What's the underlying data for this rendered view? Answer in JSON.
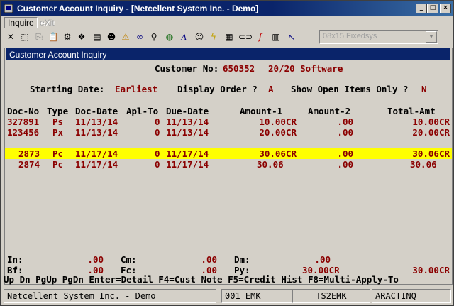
{
  "window": {
    "title": "Customer Account Inquiry - [Netcellent System Inc. - Demo]",
    "buttons": [
      "minimize",
      "maximize",
      "close"
    ]
  },
  "menu": {
    "items": [
      {
        "label": "Inquire",
        "enabled": true
      },
      {
        "label": "eXit",
        "enabled": false
      }
    ]
  },
  "toolbar": {
    "icons": [
      "close-x-icon",
      "select-icon",
      "copy-icon",
      "paste-icon",
      "settings-icon",
      "options-icon",
      "document-icon",
      "user-icon",
      "warning-icon",
      "binoculars-icon",
      "magnifier-icon",
      "globe-icon",
      "font-icon",
      "person-icon",
      "lightning-icon",
      "calculator-icon",
      "link-icon",
      "function-icon",
      "notepad-icon",
      "help-pointer-icon"
    ],
    "font_select": "08x15 Fixedsys"
  },
  "panel": {
    "title": "Customer Account Inquiry"
  },
  "header": {
    "customer_label": "Customer No:",
    "customer_no": "650352",
    "customer_name": "20/20 Software",
    "start_label": "Starting Date:",
    "start_value": "Earliest",
    "order_label": "Display Order ?",
    "order_value": "A",
    "open_label": "Show Open Items Only ?",
    "open_value": "N"
  },
  "columns": [
    "Doc-No",
    "Type",
    "Doc-Date",
    "Apl-To",
    "Due-Date",
    "Amount-1",
    "Amount-2",
    "Total-Amt"
  ],
  "rows": [
    {
      "doc_no": "327891",
      "type": "Ps",
      "doc_date": "11/13/14",
      "apl_to": "0",
      "due_date": "11/13/14",
      "amount1": "10.00CR",
      "amount2": ".00",
      "total": "10.00CR",
      "highlight": false
    },
    {
      "doc_no": "123456",
      "type": "Px",
      "doc_date": "11/13/14",
      "apl_to": "0",
      "due_date": "11/13/14",
      "amount1": "20.00CR",
      "amount2": ".00",
      "total": "20.00CR",
      "highlight": false
    },
    {
      "doc_no": "2873",
      "type": "Pc",
      "doc_date": "11/17/14",
      "apl_to": "0",
      "due_date": "11/17/14",
      "amount1": "30.06CR",
      "amount2": ".00",
      "total": "30.06CR",
      "highlight": true
    },
    {
      "doc_no": "2874",
      "type": "Pc",
      "doc_date": "11/17/14",
      "apl_to": "0",
      "due_date": "11/17/14",
      "amount1": "30.06",
      "amount2": ".00",
      "total": "30.06",
      "highlight": false
    }
  ],
  "totals": {
    "in_label": "In:",
    "in_value": ".00",
    "cm_label": "Cm:",
    "cm_value": ".00",
    "dm_label": "Dm:",
    "dm_value": ".00",
    "bf_label": "Bf:",
    "bf_value": ".00",
    "fc_label": "Fc:",
    "fc_value": ".00",
    "py_label": "Py:",
    "py_value": "30.00CR",
    "balance": "30.00CR"
  },
  "hint": "Up Dn PgUp PgDn Enter=Detail F4=Cust Note F5=Credit Hist F8=Multi-Apply-To",
  "status": {
    "company": "Netcellent System Inc. - Demo",
    "user": "001 EMK",
    "terminal": "TS2EMK",
    "program": "ARACTINQ"
  }
}
